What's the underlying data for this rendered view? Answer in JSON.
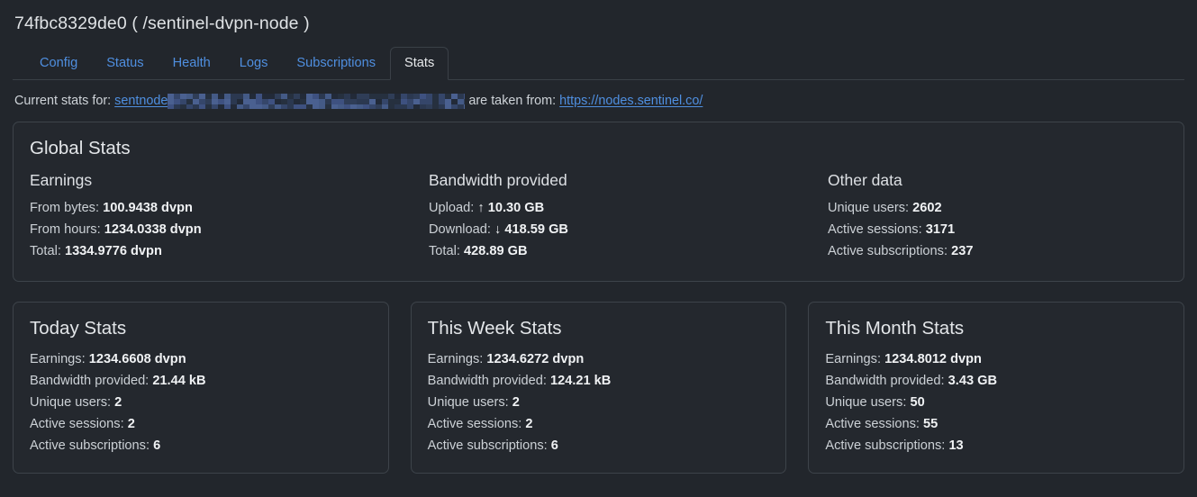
{
  "header": {
    "title": "74fbc8329de0 ( /sentinel-dvpn-node )"
  },
  "tabs": [
    {
      "label": "Config",
      "active": false
    },
    {
      "label": "Status",
      "active": false
    },
    {
      "label": "Health",
      "active": false
    },
    {
      "label": "Logs",
      "active": false
    },
    {
      "label": "Subscriptions",
      "active": false
    },
    {
      "label": "Stats",
      "active": true
    }
  ],
  "source": {
    "prefix": "Current stats for:",
    "node_link": "sentnode",
    "redacted": "",
    "middle": "are taken from:",
    "url": "https://nodes.sentinel.co/"
  },
  "global": {
    "title": "Global Stats",
    "earnings": {
      "head": "Earnings",
      "rows": [
        {
          "label": "From bytes:",
          "value": "100.9438 dvpn"
        },
        {
          "label": "From hours:",
          "value": "1234.0338 dvpn"
        },
        {
          "label": "Total:",
          "value": "1334.9776 dvpn"
        }
      ]
    },
    "bandwidth": {
      "head": "Bandwidth provided",
      "upload_label": "Upload:",
      "upload_arrow": "↑",
      "upload_value": "10.30 GB",
      "download_label": "Download:",
      "download_arrow": "↓",
      "download_value": "418.59 GB",
      "total_label": "Total:",
      "total_value": "428.89 GB"
    },
    "other": {
      "head": "Other data",
      "rows": [
        {
          "label": "Unique users:",
          "value": "2602"
        },
        {
          "label": "Active sessions:",
          "value": "3171"
        },
        {
          "label": "Active subscriptions:",
          "value": "237"
        }
      ]
    }
  },
  "period_cards": [
    {
      "title": "Today Stats",
      "rows": [
        {
          "label": "Earnings:",
          "value": "1234.6608 dvpn"
        },
        {
          "label": "Bandwidth provided:",
          "value": "21.44 kB"
        },
        {
          "label": "Unique users:",
          "value": "2"
        },
        {
          "label": "Active sessions:",
          "value": "2"
        },
        {
          "label": "Active subscriptions:",
          "value": "6"
        }
      ]
    },
    {
      "title": "This Week Stats",
      "rows": [
        {
          "label": "Earnings:",
          "value": "1234.6272 dvpn"
        },
        {
          "label": "Bandwidth provided:",
          "value": "124.21 kB"
        },
        {
          "label": "Unique users:",
          "value": "2"
        },
        {
          "label": "Active sessions:",
          "value": "2"
        },
        {
          "label": "Active subscriptions:",
          "value": "6"
        }
      ]
    },
    {
      "title": "This Month Stats",
      "rows": [
        {
          "label": "Earnings:",
          "value": "1234.8012 dvpn"
        },
        {
          "label": "Bandwidth provided:",
          "value": "3.43 GB"
        },
        {
          "label": "Unique users:",
          "value": "50"
        },
        {
          "label": "Active sessions:",
          "value": "55"
        },
        {
          "label": "Active subscriptions:",
          "value": "13"
        }
      ]
    }
  ],
  "colors": {
    "page_bg": "#22262c",
    "card_bg": "#24282e",
    "card_border": "#3d434a",
    "link": "#4f8fe0",
    "text": "#ccd1d6",
    "strong_text": "#f0f2f4"
  }
}
